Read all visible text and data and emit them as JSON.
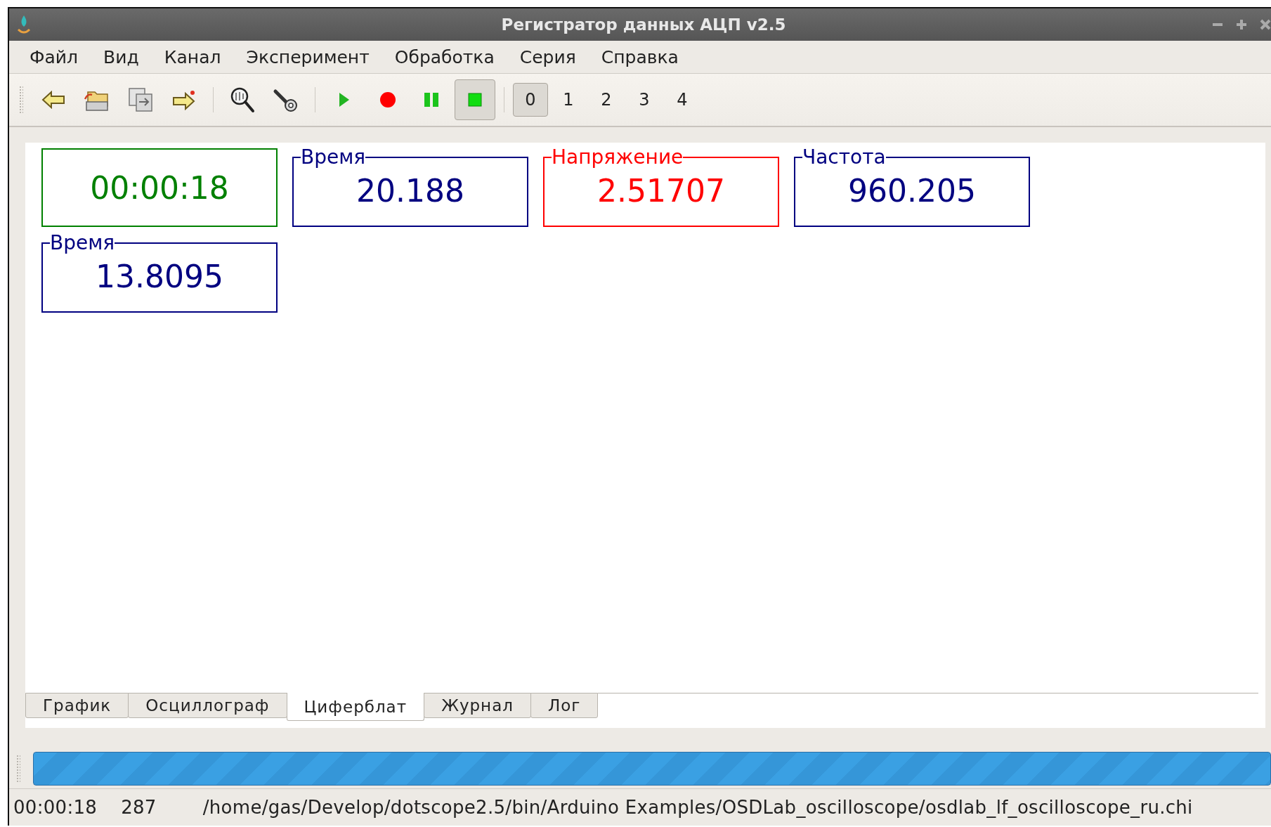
{
  "window": {
    "title": "Регистратор данных АЦП v2.5"
  },
  "menu": [
    "Файл",
    "Вид",
    "Канал",
    "Эксперимент",
    "Обработка",
    "Серия",
    "Справка"
  ],
  "toolbar": {
    "actions": [
      {
        "kind": "back",
        "pressed": false
      },
      {
        "kind": "open",
        "pressed": false
      },
      {
        "kind": "convert",
        "pressed": false
      },
      {
        "kind": "export",
        "pressed": false
      },
      {
        "kind": "zoom",
        "pressed": false
      },
      {
        "kind": "probe",
        "pressed": false
      },
      {
        "kind": "play",
        "pressed": false
      },
      {
        "kind": "record",
        "pressed": false
      },
      {
        "kind": "pause",
        "pressed": false
      },
      {
        "kind": "stop",
        "pressed": true
      }
    ],
    "channels": [
      {
        "label": "0",
        "selected": true
      },
      {
        "label": "1",
        "selected": false
      },
      {
        "label": "2",
        "selected": false
      },
      {
        "label": "3",
        "selected": false
      },
      {
        "label": "4",
        "selected": false
      }
    ]
  },
  "gauges": [
    {
      "value": "00:00:18",
      "color": "#008000"
    },
    {
      "label": "Время",
      "value": "20.188",
      "color": "#000080"
    },
    {
      "label": "Напряжение",
      "value": "2.51707",
      "color": "#ff0000"
    },
    {
      "label": "Частота",
      "value": "960.205",
      "color": "#000080"
    },
    {
      "label": "Время",
      "value": "13.8095",
      "color": "#000080"
    }
  ],
  "tabs": [
    {
      "label": "График",
      "selected": false
    },
    {
      "label": "Осциллограф",
      "selected": false
    },
    {
      "label": "Циферблат",
      "selected": true
    },
    {
      "label": "Журнал",
      "selected": false
    },
    {
      "label": "Лог",
      "selected": false
    }
  ],
  "progress": {
    "level": 1
  },
  "status_bar": {
    "time": "00:00:18",
    "count": "287",
    "file": "/home/gas/Develop/dotscope2.5/bin/Arduino Examples/OSDLab_oscilloscope/osdlab_lf_oscilloscope_ru.chi"
  }
}
